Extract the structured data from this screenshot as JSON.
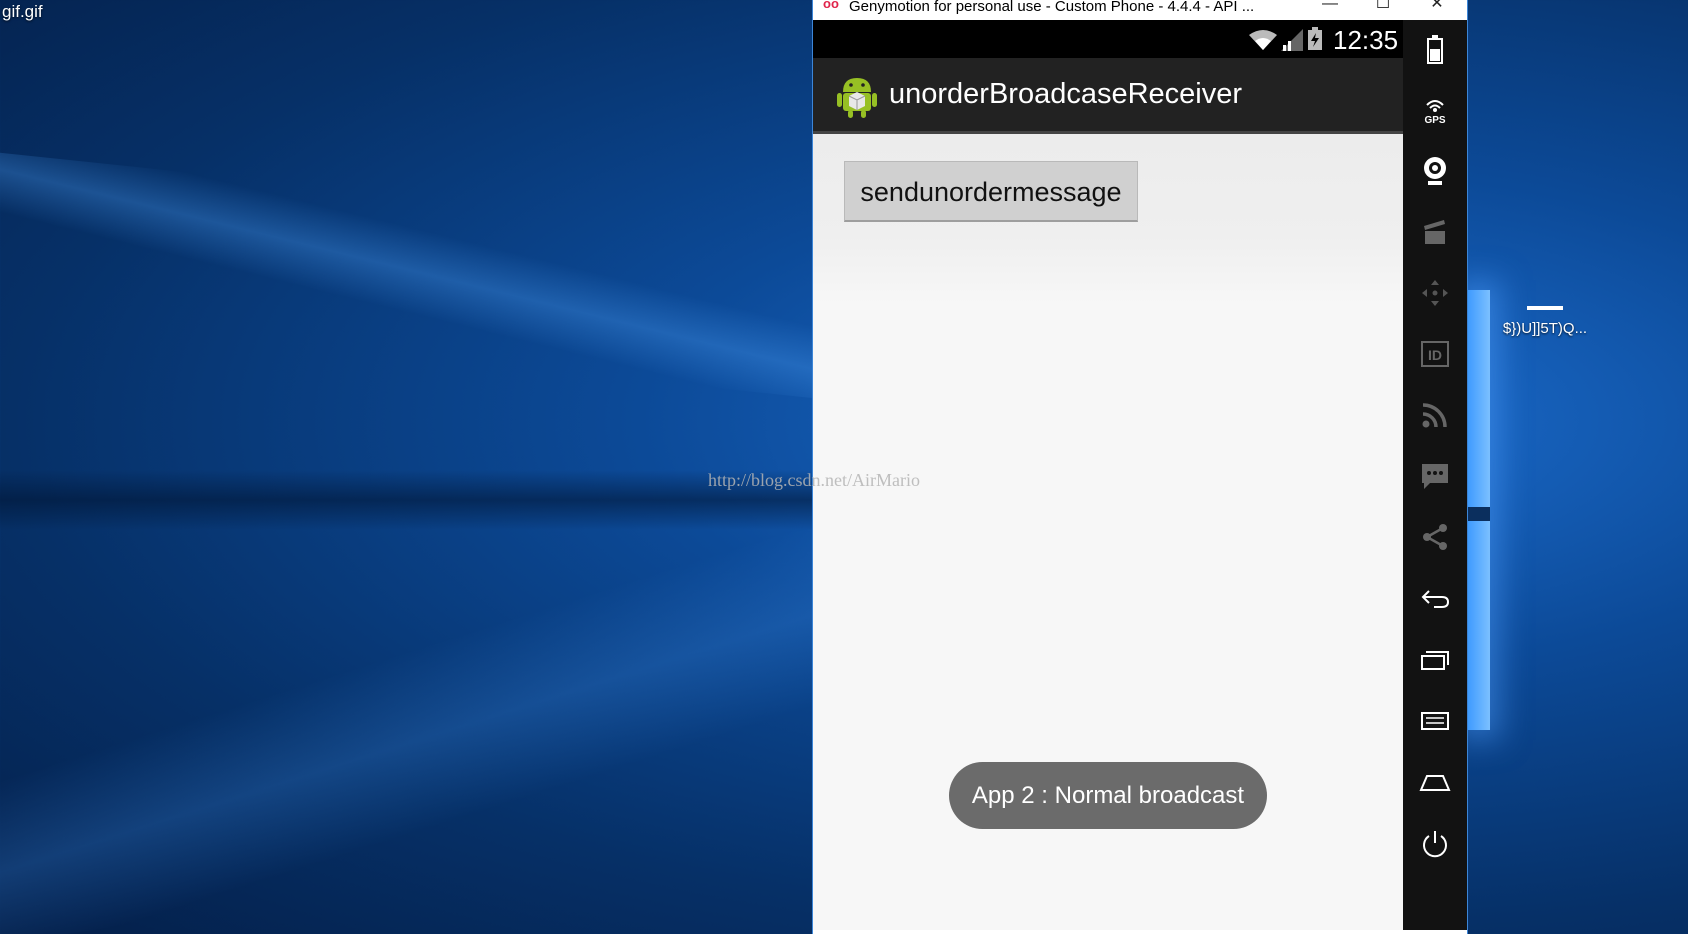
{
  "desktop": {
    "file_label": "gif.gif",
    "icon_label": "$})U]]5T)Q..."
  },
  "window": {
    "title": "Genymotion for personal use - Custom Phone - 4.4.4 - API ...",
    "controls": {
      "minimize": "—",
      "maximize": "☐",
      "close": "✕"
    }
  },
  "statusbar": {
    "time": "12:35"
  },
  "app": {
    "title": "unorderBroadcaseReceiver",
    "button_label": "sendunordermessage",
    "watermark": "http://blog.csdn.net/AirMario",
    "toast": "App 2 : Normal broadcast"
  },
  "side_panel": {
    "gps_label": "GPS",
    "id_label": "ID",
    "items": [
      "battery-icon",
      "gps-icon",
      "camera-icon",
      "media-icon",
      "dpad-icon",
      "id-icon",
      "rss-icon",
      "sms-icon",
      "share-icon",
      "back-icon",
      "recent-apps-icon",
      "menu-icon",
      "home-icon",
      "power-icon"
    ]
  },
  "colors": {
    "desktop_blue": "#0c4a98",
    "toast_bg": "#6b6b6b",
    "actionbar_bg": "#222222",
    "side_panel_bg": "#121212",
    "genymotion_accent": "#e0244a"
  }
}
